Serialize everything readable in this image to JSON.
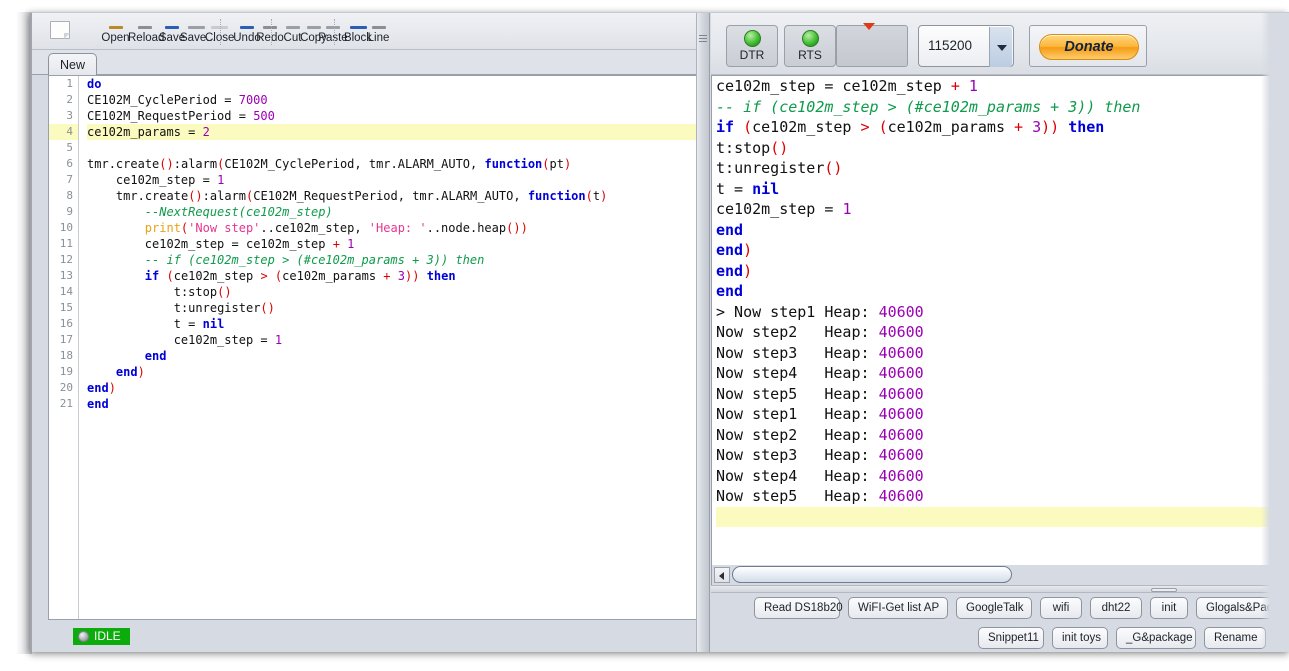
{
  "editor": {
    "toolbar": {
      "items": [
        {
          "label": "Open",
          "icon": "folder-open-icon",
          "color": "#b98a2a"
        },
        {
          "label": "Reload",
          "icon": "reload-icon",
          "color": "#8a8f97"
        },
        {
          "label": "Save",
          "icon": "save-icon",
          "color": "#2b5fb5"
        },
        {
          "label": "Save...",
          "icon": "save-as-icon",
          "color": "#9aa0aa"
        },
        {
          "label": "Close",
          "icon": "close-icon",
          "color": "#c8ccd2"
        },
        {
          "label": "Undo",
          "icon": "undo-icon",
          "color": "#2b5fb5"
        },
        {
          "label": "Redo",
          "icon": "redo-icon",
          "color": "#8a8f97"
        },
        {
          "label": "Cut",
          "icon": "scissors-icon",
          "color": "#9aa0aa"
        },
        {
          "label": "Copy",
          "icon": "copy-icon",
          "color": "#9aa0aa"
        },
        {
          "label": "Paste",
          "icon": "clipboard-icon",
          "color": "#9aa0aa"
        },
        {
          "label": "Block",
          "icon": "block-comment-icon",
          "color": "#2b5fb5"
        },
        {
          "label": "Line",
          "icon": "line-comment-icon",
          "color": "#8a8f97"
        }
      ],
      "new_file_icon": "new-document-icon"
    },
    "tabs": [
      {
        "label": "New",
        "active": true
      }
    ],
    "line_numbers": [
      "1",
      "2",
      "3",
      "4",
      "5",
      "6",
      "7",
      "8",
      "9",
      "10",
      "11",
      "12",
      "13",
      "14",
      "15",
      "16",
      "17",
      "18",
      "19",
      "20",
      "21"
    ],
    "highlighted_line": 4,
    "code_lines": [
      "do",
      "CE102M_CyclePeriod = 7000",
      "CE102M_RequestPeriod = 500",
      "ce102m_params = 2",
      "",
      "tmr.create():alarm(CE102M_CyclePeriod, tmr.ALARM_AUTO, function(pt)",
      "    ce102m_step = 1",
      "    tmr.create():alarm(CE102M_RequestPeriod, tmr.ALARM_AUTO, function(t)",
      "        --NextRequest(ce102m_step)",
      "        print('Now step'..ce102m_step, 'Heap: '..node.heap())",
      "        ce102m_step = ce102m_step + 1",
      "        -- if (ce102m_step > (#ce102m_params + 3)) then",
      "        if (ce102m_step > (ce102m_params + 3)) then",
      "            t:stop()",
      "            t:unregister()",
      "            t = nil",
      "            ce102m_step = 1",
      "        end",
      "    end)",
      "end)",
      "end"
    ],
    "status": {
      "label": "IDLE",
      "led_icon": "status-led-icon",
      "background_color": "#0bac0b",
      "text_color": "#ffffff"
    }
  },
  "terminal": {
    "toolbar": {
      "dtr": {
        "label": "DTR",
        "led_icon": "green-led-icon",
        "led_color": "#39b52b"
      },
      "rts": {
        "label": "RTS",
        "led_icon": "green-led-icon",
        "led_color": "#39b52b"
      },
      "blank_button": {
        "label": "",
        "marker_icon": "red-arrow-icon",
        "marker_color": "#e03a14"
      },
      "baud": {
        "value": "115200",
        "dropdown_icon": "chevron-down-icon"
      },
      "donate": {
        "label": "Donate",
        "color": "#f59b12"
      }
    },
    "lines": [
      "ce102m_step = ce102m_step + 1",
      "-- if (ce102m_step > (#ce102m_params + 3)) then",
      "if (ce102m_step > (ce102m_params + 3)) then",
      "t:stop()",
      "t:unregister()",
      "t = nil",
      "ce102m_step = 1",
      "end",
      "end)",
      "end)",
      "end",
      "> Now step1 Heap: 40600",
      "Now step2   Heap: 40600",
      "Now step3   Heap: 40600",
      "Now step4   Heap: 40600",
      "Now step5   Heap: 40600",
      "Now step1   Heap: 40600",
      "Now step2   Heap: 40600",
      "Now step3   Heap: 40600",
      "Now step4   Heap: 40600",
      "Now step5   Heap: 40600",
      ""
    ],
    "scrollbar": {
      "left_arrow_icon": "arrow-left-icon"
    },
    "snippet_buttons_row1": [
      "Read DS18b20",
      "WiFI-Get list AP",
      "GoogleTalk",
      "wifi",
      "dht22",
      "init",
      "Glogals&Pack"
    ],
    "snippet_buttons_row2": [
      "Snippet11",
      "init toys",
      "_G&package",
      "Rename"
    ]
  }
}
